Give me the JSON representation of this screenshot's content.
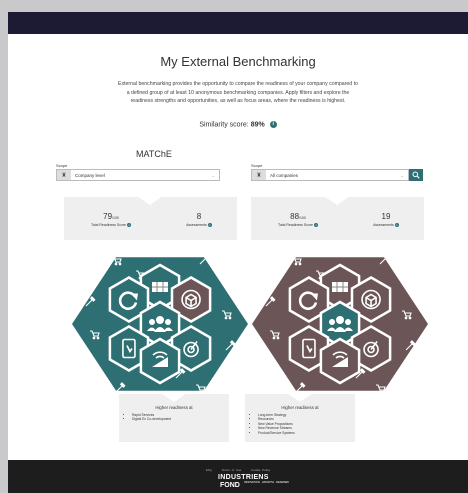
{
  "page": {
    "title": "My External Benchmarking",
    "description": "External benchmarking provides the opportunity to compare the readiness of your company compared to a defined group of at least 10 anonymous benchmarking companies. Apply filters and explore the readiness strengths and opportunities, as well as focus areas, where the readiness is highest.",
    "similarity_label": "Similarity score:",
    "similarity_value": "89%",
    "info_glyph": "i"
  },
  "left": {
    "heading": "MATChE",
    "scope_label": "Scope",
    "scope_value": "Company level",
    "chevron": "⌄",
    "score_value": "79",
    "score_max": "/100",
    "score_label": "Total Readiness Score",
    "assess_value": "8",
    "assess_label": "Assessments",
    "higher_label": "Higher readiness at",
    "higher_items": [
      "Rapid Services",
      "Digital Ex Co-development"
    ]
  },
  "right": {
    "scope_label": "Scope",
    "scope_value": "All companies",
    "chevron": "⌄",
    "score_value": "88",
    "score_max": "/100",
    "score_label": "Total Readiness Score",
    "assess_value": "19",
    "assess_label": "Assessments",
    "higher_label": "Higher readiness at",
    "higher_items": [
      "Long-term Strategy",
      "Resources",
      "New Value Propositions",
      "New Revenue Streams",
      "Product/Service Systems"
    ]
  },
  "hex_left": {
    "fills": [
      "#2e6f73",
      "#6b5556",
      "#2e6f73",
      "#2e6f73",
      "#2e6f73",
      "#2e6f73",
      "#2e6f73"
    ],
    "outer": "#2e6f73",
    "inner_icons": [
      "building-icon",
      "cube-icon",
      "refresh-icon",
      "people-icon",
      "target-icon",
      "tablet-icon",
      "signal-icon"
    ]
  },
  "hex_right": {
    "fills": [
      "#6b5556",
      "#6b5556",
      "#6b5556",
      "#2e6f73",
      "#6b5556",
      "#6b5556",
      "#6b5556"
    ],
    "outer": "#6b5556",
    "inner_icons": [
      "building-icon",
      "cube-icon",
      "refresh-icon",
      "people-icon",
      "target-icon",
      "tablet-icon",
      "signal-icon"
    ]
  },
  "footer": {
    "links": [
      "FAQ",
      "Terms of Use",
      "Cookie Policy"
    ],
    "logo_line1": "INDUSTRIENS",
    "logo_line2": "FOND",
    "logo_sub": "INNOVATION · GROWTH · DENMARK"
  }
}
